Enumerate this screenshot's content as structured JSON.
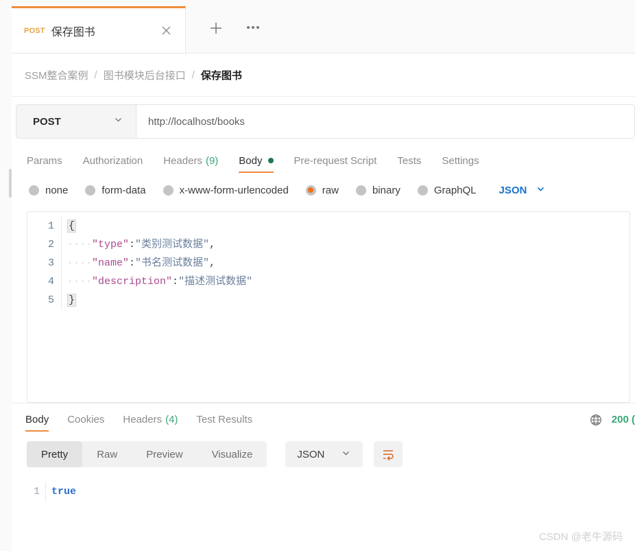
{
  "tab": {
    "method": "POST",
    "title": "保存图书",
    "close_icon": "close-icon",
    "new_tab_icon": "plus-icon",
    "more_icon": "ellipsis-icon"
  },
  "breadcrumb": {
    "items": [
      "SSM整合案例",
      "图书模块后台接口",
      "保存图书"
    ],
    "separator": "/"
  },
  "request": {
    "method": "POST",
    "url": "http://localhost/books",
    "tabs": [
      {
        "label": "Params",
        "active": false
      },
      {
        "label": "Authorization",
        "active": false
      },
      {
        "label": "Headers",
        "count": "(9)",
        "active": false
      },
      {
        "label": "Body",
        "active": true,
        "dot": true
      },
      {
        "label": "Pre-request Script",
        "active": false
      },
      {
        "label": "Tests",
        "active": false
      },
      {
        "label": "Settings",
        "active": false
      }
    ],
    "body_types": [
      {
        "label": "none",
        "selected": false
      },
      {
        "label": "form-data",
        "selected": false
      },
      {
        "label": "x-www-form-urlencoded",
        "selected": false
      },
      {
        "label": "raw",
        "selected": true
      },
      {
        "label": "binary",
        "selected": false
      },
      {
        "label": "GraphQL",
        "selected": false
      }
    ],
    "format": "JSON",
    "body_lines": [
      {
        "n": "1",
        "open_brace": "{"
      },
      {
        "n": "2",
        "indent": "····",
        "key": "\"type\"",
        "colon": ":",
        "value": "\"类别测试数据\"",
        "comma": ","
      },
      {
        "n": "3",
        "indent": "····",
        "key": "\"name\"",
        "colon": ":",
        "value": "\"书名测试数据\"",
        "comma": ","
      },
      {
        "n": "4",
        "indent": "····",
        "key": "\"description\"",
        "colon": ":",
        "value": "\"描述测试数据\"",
        "comma": ""
      },
      {
        "n": "5",
        "close_brace": "}"
      }
    ]
  },
  "response": {
    "tabs": [
      {
        "label": "Body",
        "active": true
      },
      {
        "label": "Cookies",
        "active": false
      },
      {
        "label": "Headers",
        "count": "(4)",
        "active": false
      },
      {
        "label": "Test Results",
        "active": false
      }
    ],
    "globe_icon": "globe-icon",
    "status": "200 (",
    "view_modes": [
      {
        "label": "Pretty",
        "active": true
      },
      {
        "label": "Raw",
        "active": false
      },
      {
        "label": "Preview",
        "active": false
      },
      {
        "label": "Visualize",
        "active": false
      }
    ],
    "format": "JSON",
    "wrap_icon": "wrap-text-icon",
    "body_lines": [
      {
        "n": "1",
        "text": "true"
      }
    ]
  },
  "watermark": "CSDN @老牛源码",
  "colors": {
    "accent_orange": "#ef8b3c",
    "method_orange": "#e8a33d",
    "green": "#3aa675",
    "blue": "#1a73cc",
    "raw_dot": "#f2711c"
  }
}
